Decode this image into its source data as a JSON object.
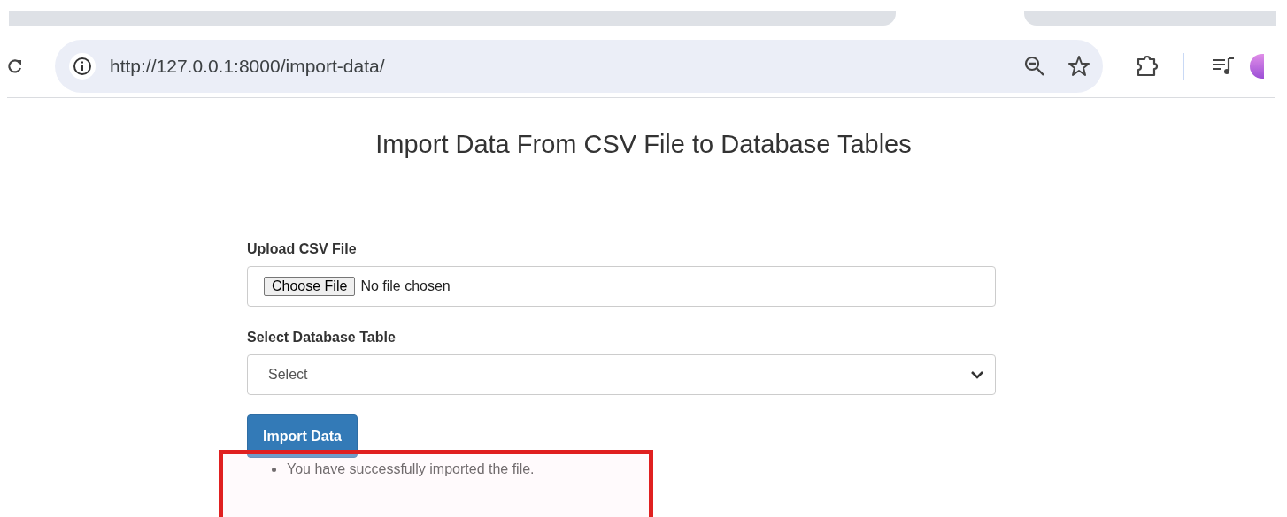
{
  "browser": {
    "url": "http://127.0.0.1:8000/import-data/"
  },
  "page": {
    "title": "Import Data From CSV File to Database Tables",
    "upload": {
      "label": "Upload CSV File",
      "button": "Choose File",
      "status": "No file chosen"
    },
    "table_select": {
      "label": "Select Database Table",
      "value": "Select"
    },
    "submit": "Import Data",
    "messages": [
      "You have successfully imported the file."
    ],
    "highlight": {
      "on": true
    }
  }
}
